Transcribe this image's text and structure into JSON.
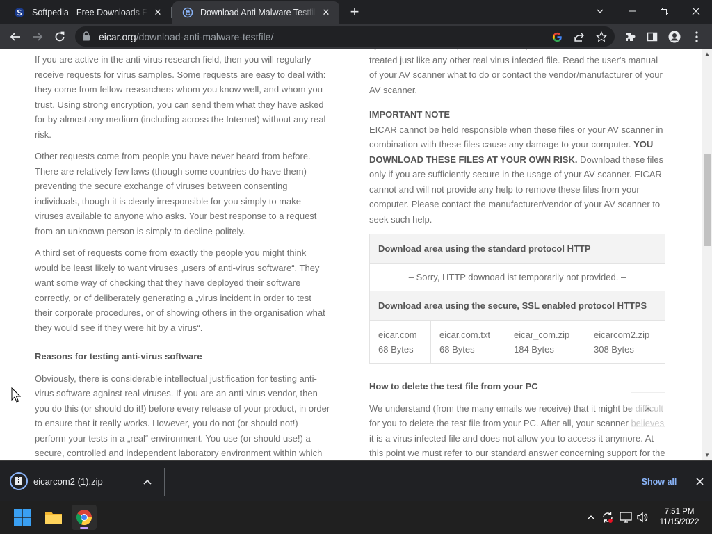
{
  "browser": {
    "tabs": [
      {
        "title": "Softpedia - Free Downloads Encyclopedia",
        "active": false
      },
      {
        "title": "Download Anti Malware Testfile - EICAR",
        "active": true
      }
    ],
    "url_host": "eicar.org",
    "url_path": "/download-anti-malware-testfile/"
  },
  "left_column": {
    "paragraphs": [
      "If you are active in the anti-virus research field, then you will regularly receive requests for virus samples. Some requests are easy to deal with: they come from fellow-researchers whom you know well, and whom you trust. Using strong encryption, you can send them what they have asked for by almost any medium (including across the Internet) without any real risk.",
      "Other requests come from people you have never heard from before. There are relatively few laws (though some countries do have them) preventing the secure exchange of viruses between consenting individuals, though it is clearly irresponsible for you simply to make viruses available to anyone who asks. Your best response to a request from an unknown person is simply to decline politely.",
      "A third set of requests come from exactly the people you might think would be least likely to want viruses „users of anti-virus software“. They want some way of checking that they have deployed their software correctly, or of deliberately generating a „virus incident in order to test their corporate procedures, or of showing others in the organisation what they would see if they were hit by a virus“."
    ],
    "heading": "Reasons for testing anti-virus software",
    "last_paragraph": "Obviously, there is considerable intellectual justification for testing anti-virus software against real viruses. If you are an anti-virus vendor, then you do this (or should do it!) before every release of your product, in order to ensure that it really works. However, you do not (or should not!) perform your tests in a „real“ environment. You use (or should use!) a secure, controlled and independent laboratory environment within which"
  },
  "right_column": {
    "intro": "by the scanner which puts the file into quarantaine. The test file will be treated just like any other real virus infected file. Read the user's manual of your AV scanner what to do or contact the vendor/manufacturer of your AV scanner.",
    "important_heading": "IMPORTANT NOTE",
    "important_text_1": "EICAR cannot be held responsible when these files or your AV scanner in combination with these files cause any damage to your computer.",
    "important_strong": "YOU DOWNLOAD THESE FILES AT YOUR OWN RISK.",
    "important_text_2": " Download these files only if you are sufficiently secure in the usage of your AV scanner. EICAR cannot and will not provide any help to remove these files from your computer. Please contact the manufacturer/vendor of your AV scanner to seek such help.",
    "http_heading": "Download area using the standard protocol HTTP",
    "http_message": "– Sorry, HTTP downoad ist temporarily not provided. –",
    "https_heading": "Download area using the secure, SSL enabled protocol HTTPS",
    "files": [
      {
        "name": "eicar.com",
        "size": "68 Bytes"
      },
      {
        "name": "eicar.com.txt",
        "size": "68 Bytes"
      },
      {
        "name": "eicar_com.zip",
        "size": "184 Bytes"
      },
      {
        "name": "eicarcom2.zip",
        "size": "308 Bytes"
      }
    ],
    "how_heading": "How to delete the test file from your PC",
    "how_text": "We understand (from the many emails we receive) that it might be difficult for you to delete the test file from your PC. After all, your scanner believes it is a virus infected file and does not allow you to access it anymore. At this point we must refer to our standard answer concerning support for the"
  },
  "download_shelf": {
    "filename": "eicarcom2 (1).zip",
    "show_all_label": "Show all"
  },
  "taskbar": {
    "time": "7:51 PM",
    "date": "11/15/2022"
  },
  "colors": {
    "browser_dark": "#202124",
    "toolbar": "#35363a",
    "link_blue": "#8ab4f8",
    "body_text": "#6f6f6f"
  }
}
